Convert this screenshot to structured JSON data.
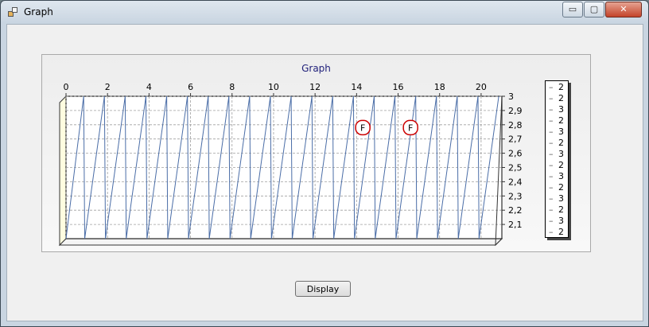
{
  "window": {
    "title": "Graph",
    "controls": {
      "minimize": "▭",
      "maximize": "▢",
      "close": "✕"
    }
  },
  "chart_data": {
    "type": "line",
    "title": "Graph",
    "xlabel": "",
    "ylabel": "",
    "xlim": [
      0,
      21
    ],
    "ylim": [
      2,
      3
    ],
    "x_ticks": [
      "0",
      "2",
      "4",
      "6",
      "8",
      "10",
      "12",
      "14",
      "16",
      "18",
      "20"
    ],
    "y_ticks": [
      "3",
      "2,9",
      "2,8",
      "2,7",
      "2,6",
      "2,5",
      "2,4",
      "2,3",
      "2,2",
      "2,1"
    ],
    "grid": true,
    "three_d": true,
    "series": [
      {
        "color": "#4a6da7",
        "pattern": "sawtooth",
        "x": [
          0,
          0.85,
          0.9,
          1.85,
          1.9,
          2.85,
          2.9,
          3.85,
          3.9,
          4.85,
          4.9,
          5.85,
          5.9,
          6.85,
          6.9,
          7.85,
          7.9,
          8.85,
          8.9,
          9.85,
          9.9,
          10.85,
          10.9,
          11.85,
          11.9,
          12.85,
          12.9,
          13.85,
          13.9,
          14.85,
          14.9,
          15.85,
          15.9,
          16.85,
          16.9,
          17.85,
          17.9,
          18.85,
          18.9,
          19.85,
          19.9,
          20.85
        ],
        "y": [
          2,
          3,
          2,
          3,
          2,
          3,
          2,
          3,
          2,
          3,
          2,
          3,
          2,
          3,
          2,
          3,
          2,
          3,
          2,
          3,
          2,
          3,
          2,
          3,
          2,
          3,
          2,
          3,
          2,
          3,
          2,
          3,
          2,
          3,
          2,
          3,
          2,
          3,
          2,
          3,
          2,
          3
        ]
      }
    ],
    "annotations": [
      {
        "text": "F",
        "x": 14.3,
        "y": 2.78,
        "color": "#cc0000"
      },
      {
        "text": "F",
        "x": 16.6,
        "y": 2.78,
        "color": "#cc0000"
      }
    ],
    "legend": {
      "placement": "right",
      "entries": [
        "2",
        "2",
        "3",
        "2",
        "3",
        "2",
        "3",
        "2",
        "3",
        "2",
        "3",
        "2",
        "3",
        "2"
      ]
    }
  },
  "buttons": {
    "display": "Display"
  }
}
